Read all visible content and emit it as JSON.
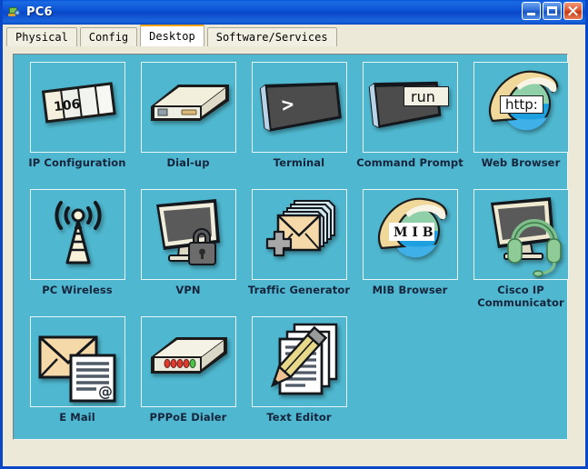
{
  "window": {
    "title": "PC6",
    "icon": "packet-tracer-device-icon",
    "controls": {
      "minimize": "Minimize",
      "maximize": "Maximize",
      "close": "Close"
    }
  },
  "tabs": [
    {
      "label": "Physical",
      "active": false
    },
    {
      "label": "Config",
      "active": false
    },
    {
      "label": "Desktop",
      "active": true
    },
    {
      "label": "Software/Services",
      "active": false
    }
  ],
  "colors": {
    "desktop_background": "#4fb8d0",
    "tile_border": "#e8f6fa",
    "label_text": "#16243c",
    "title_bar": "#0a46c8",
    "active_tab_accent": "#f0a500",
    "window_chrome": "#ece9d8"
  },
  "desktop": {
    "items": [
      {
        "label": "IP Configuration",
        "icon": "ip-configuration-icon",
        "badge": "106"
      },
      {
        "label": "Dial-up",
        "icon": "dial-up-modem-icon"
      },
      {
        "label": "Terminal",
        "icon": "terminal-icon",
        "glyph": ">"
      },
      {
        "label": "Command Prompt",
        "icon": "command-prompt-icon",
        "badge": "run"
      },
      {
        "label": "Web Browser",
        "icon": "web-browser-globe-icon",
        "badge": "http:"
      },
      {
        "label": "PC Wireless",
        "icon": "pc-wireless-antenna-icon"
      },
      {
        "label": "VPN",
        "icon": "vpn-monitor-lock-icon"
      },
      {
        "label": "Traffic Generator",
        "icon": "traffic-generator-envelopes-icon"
      },
      {
        "label": "MIB Browser",
        "icon": "mib-browser-globe-icon",
        "badge": "M I B"
      },
      {
        "label": "Cisco IP Communicator",
        "icon": "cisco-ip-communicator-headset-icon"
      },
      {
        "label": "E Mail",
        "icon": "email-envelope-letter-icon",
        "badge": "@"
      },
      {
        "label": "PPPoE Dialer",
        "icon": "pppoe-dialer-device-icon"
      },
      {
        "label": "Text Editor",
        "icon": "text-editor-pencil-document-icon"
      }
    ]
  }
}
